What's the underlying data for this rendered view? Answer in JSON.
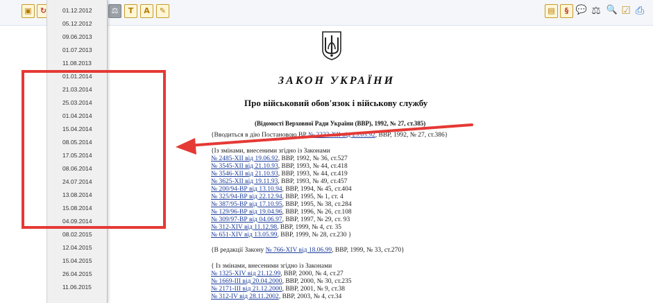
{
  "toolbar": {
    "left_buttons": [
      {
        "name": "briefcase-icon",
        "glyph": "▣"
      },
      {
        "name": "history-icon",
        "glyph": "↻"
      },
      {
        "name": "scales-icon",
        "glyph": "⚖"
      },
      {
        "name": "text-t-icon",
        "glyph": "T"
      },
      {
        "name": "text-a-icon",
        "glyph": "A"
      },
      {
        "name": "pencil-icon",
        "glyph": "✎"
      }
    ],
    "right_buttons": [
      {
        "name": "document-icon",
        "glyph": "▤"
      },
      {
        "name": "paragraph-icon",
        "glyph": "§"
      },
      {
        "name": "comments-icon",
        "glyph": "💬"
      },
      {
        "name": "scales-right-icon",
        "glyph": "⚖"
      },
      {
        "name": "search-icon",
        "glyph": "🔍"
      },
      {
        "name": "checklist-icon",
        "glyph": "☑"
      },
      {
        "name": "print-icon",
        "glyph": "⎙"
      }
    ]
  },
  "dates_panel": {
    "items": [
      "01.12.2012",
      "05.12.2012",
      "09.06.2013",
      "01.07.2013",
      "11.08.2013",
      "01.01.2014",
      "21.03.2014",
      "25.03.2014",
      "01.04.2014",
      "15.04.2014",
      "08.05.2014",
      "17.05.2014",
      "08.06.2014",
      "24.07.2014",
      "13.08.2014",
      "15.08.2014",
      "04.09.2014",
      "08.02.2015",
      "12.04.2015",
      "15.04.2015",
      "26.04.2015",
      "11.06.2015"
    ]
  },
  "document": {
    "title": "ЗАКОН УКРАЇНИ",
    "subtitle": "Про військовий обов'язок і військову службу",
    "source": "(Відомості Верховної Ради України (ВВР), 1992, № 27, ст.385)",
    "enact_prefix": "{Вводиться в дію Постановою ВР ",
    "enact_link": "№ 2233-XII від 25.03.92",
    "enact_suffix": ", ВВР, 1992, № 27, ст.386}",
    "amend_header_1": "{Із змінами, внесеними згідно із Законами",
    "amendments_1": [
      {
        "link": "№ 2485-XII від 19.06.92",
        "rest": ", ВВР, 1992, № 36, ст.527"
      },
      {
        "link": "№ 3545-XII від 21.10.93",
        "rest": ", ВВР, 1993, № 44, ст.418"
      },
      {
        "link": "№ 3546-XII від 21.10.93",
        "rest": ", ВВР, 1993, № 44, ст.419"
      },
      {
        "link": "№ 3625-XII від 19.11.93",
        "rest": ", ВВР, 1993, № 49, ст.457"
      },
      {
        "link": "№ 200/94-ВР від 13.10.94",
        "rest": ", ВВР, 1994, № 45, ст.404"
      },
      {
        "link": "№ 325/94-ВР від 22.12.94",
        "rest": ", ВВР, 1995, №  1, ст.  4"
      },
      {
        "link": "№ 387/95-ВР від 17.10.95",
        "rest": ", ВВР, 1995, № 38, ст.284"
      },
      {
        "link": "№ 129/96-ВР від 19.04.96",
        "rest": ", ВВР, 1996, № 26, ст.108"
      },
      {
        "link": "№ 309/97-ВР від 04.06.97",
        "rest": ", ВВР, 1997, № 29, ст. 93"
      },
      {
        "link": "№ 312-XIV від 11.12.98",
        "rest": ", ВВР, 1999, № 4,  ст. 35"
      },
      {
        "link": "№ 651-XIV від 13.05.99",
        "rest": ", ВВР, 1999, № 28, ст.230 }"
      }
    ],
    "redaction_prefix": "{В редакції Закону ",
    "redaction_link": "№ 766-XIV від 18.06.99",
    "redaction_suffix": ", ВВР, 1999, № 33, ст.270}",
    "amend_header_2": "{ Із змінами, внесеними згідно із Законами",
    "amendments_2": [
      {
        "link": "№ 1325-XIV від 21.12.99",
        "rest": ", ВВР, 2000, № 4, ст.27"
      },
      {
        "link": "№ 1669-III від 20.04.2000",
        "rest": ", ВВР, 2000, № 30, ст.235"
      },
      {
        "link": "№ 2171-III від 21.12.2000",
        "rest": ", ВВР, 2001, № 9, ст.38"
      },
      {
        "link": "№ 312-IV від 28.11.2002",
        "rest": ", ВВР, 2003, № 4, ст.34"
      }
    ]
  },
  "annotation": {
    "box_color": "#e53935",
    "arrow_color": "#e53935"
  }
}
